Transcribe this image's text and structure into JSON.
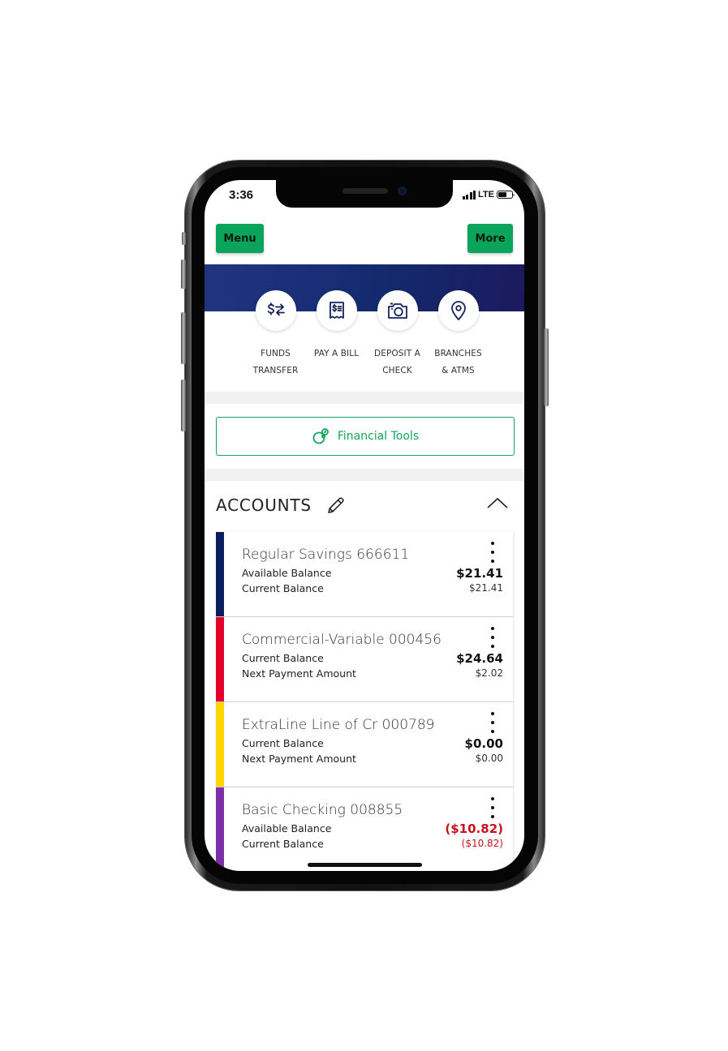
{
  "status_bar": {
    "time": "3:36",
    "network": "LTE",
    "battery_level": 0.6,
    "signal_bars": 4
  },
  "header": {
    "menu_label": "Menu",
    "more_label": "More",
    "accent_color": "#0aa55a"
  },
  "quick_actions": [
    {
      "icon": "funds-transfer-icon",
      "line1": "FUNDS",
      "line2": "TRANSFER"
    },
    {
      "icon": "receipt-bill-icon",
      "line1": "PAY A BILL",
      "line2": ""
    },
    {
      "icon": "camera-icon",
      "line1": "DEPOSIT A",
      "line2": "CHECK"
    },
    {
      "icon": "location-pin-icon",
      "line1": "BRANCHES",
      "line2": "& ATMS"
    }
  ],
  "financial_tools": {
    "label": "Financial Tools",
    "icon": "financial-tools-icon",
    "color": "#12a55e"
  },
  "accounts": {
    "title": "ACCOUNTS",
    "items": [
      {
        "name": "Regular Savings 666611",
        "color": "#0b1f5c",
        "label1": "Available Balance",
        "value1": "$21.41",
        "label2": "Current Balance",
        "value2": "$21.41",
        "negative": false
      },
      {
        "name": "Commercial-Variable 000456",
        "color": "#e4002b",
        "label1": "Current Balance",
        "value1": "$24.64",
        "label2": "Next Payment Amount",
        "value2": "$2.02",
        "negative": false
      },
      {
        "name": "ExtraLine Line of Cr 000789",
        "color": "#ffd500",
        "label1": "Current Balance",
        "value1": "$0.00",
        "label2": "Next Payment Amount",
        "value2": "$0.00",
        "negative": false
      },
      {
        "name": "Basic Checking 008855",
        "color": "#7b2fa8",
        "label1": "Available Balance",
        "value1": "($10.82)",
        "label2": "Current Balance",
        "value2": "($10.82)",
        "negative": true
      }
    ]
  }
}
